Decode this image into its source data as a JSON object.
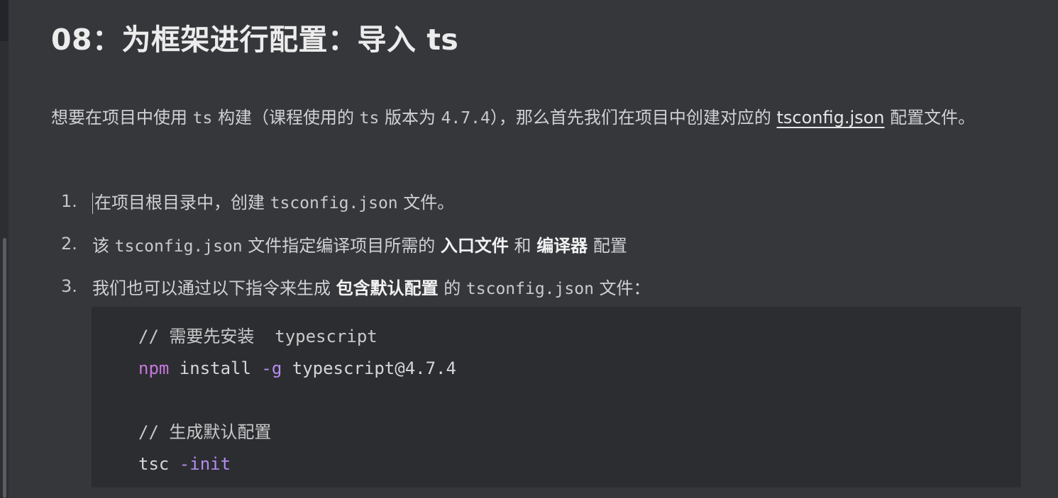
{
  "title": "08：为框架进行配置：导入 ts",
  "intro": {
    "p1": "想要在项目中使用 ",
    "code1": "ts",
    "p2": " 构建（课程使用的 ",
    "code2": "ts",
    "p3": " 版本为 ",
    "code3": "4.7.4",
    "p4": "），那么首先我们在项目中创建对应的 ",
    "link": "tsconfig.json",
    "p5": " 配置文件。"
  },
  "steps": [
    {
      "num": "1.",
      "a": "在项目根目录中，创建 ",
      "code": "tsconfig.json",
      "b": " 文件。"
    },
    {
      "num": "2.",
      "a": "该 ",
      "code": "tsconfig.json",
      "b": " 文件指定编译项目所需的 ",
      "strong1": "入口文件",
      "c": " 和 ",
      "strong2": "编译器",
      "d": " 配置"
    },
    {
      "num": "3.",
      "a": "我们也可以通过以下指令来生成 ",
      "strong1": "包含默认配置",
      "b": " 的 ",
      "code": "tsconfig.json",
      "c": " 文件："
    }
  ],
  "code": {
    "comment1": "// 需要先安装  typescript",
    "cmd1_kw": "npm",
    "cmd1_mid": " install ",
    "cmd1_flag": "-g",
    "cmd1_arg": " typescript@4.7.4",
    "comment2": "// 生成默认配置",
    "cmd2": "tsc ",
    "cmd2_flag": "-init"
  }
}
